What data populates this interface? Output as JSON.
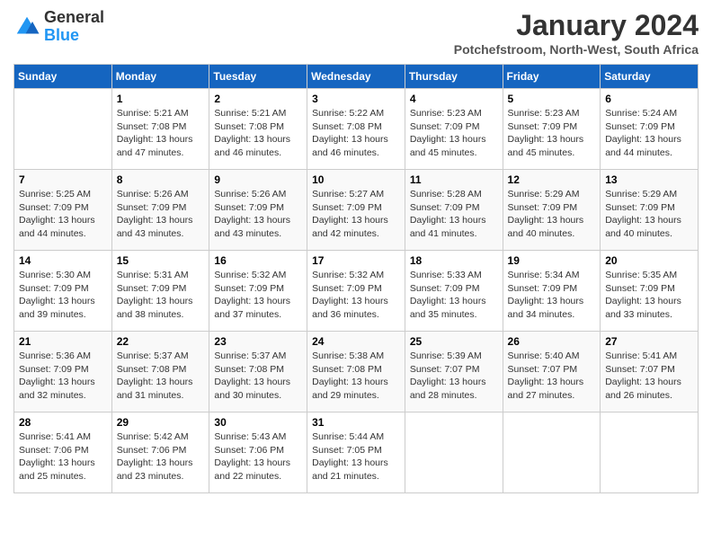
{
  "header": {
    "logo_general": "General",
    "logo_blue": "Blue",
    "month_year": "January 2024",
    "location": "Potchefstroom, North-West, South Africa"
  },
  "days_of_week": [
    "Sunday",
    "Monday",
    "Tuesday",
    "Wednesday",
    "Thursday",
    "Friday",
    "Saturday"
  ],
  "weeks": [
    [
      {
        "day": "",
        "info": ""
      },
      {
        "day": "1",
        "info": "Sunrise: 5:21 AM\nSunset: 7:08 PM\nDaylight: 13 hours\nand 47 minutes."
      },
      {
        "day": "2",
        "info": "Sunrise: 5:21 AM\nSunset: 7:08 PM\nDaylight: 13 hours\nand 46 minutes."
      },
      {
        "day": "3",
        "info": "Sunrise: 5:22 AM\nSunset: 7:08 PM\nDaylight: 13 hours\nand 46 minutes."
      },
      {
        "day": "4",
        "info": "Sunrise: 5:23 AM\nSunset: 7:09 PM\nDaylight: 13 hours\nand 45 minutes."
      },
      {
        "day": "5",
        "info": "Sunrise: 5:23 AM\nSunset: 7:09 PM\nDaylight: 13 hours\nand 45 minutes."
      },
      {
        "day": "6",
        "info": "Sunrise: 5:24 AM\nSunset: 7:09 PM\nDaylight: 13 hours\nand 44 minutes."
      }
    ],
    [
      {
        "day": "7",
        "info": "Sunrise: 5:25 AM\nSunset: 7:09 PM\nDaylight: 13 hours\nand 44 minutes."
      },
      {
        "day": "8",
        "info": "Sunrise: 5:26 AM\nSunset: 7:09 PM\nDaylight: 13 hours\nand 43 minutes."
      },
      {
        "day": "9",
        "info": "Sunrise: 5:26 AM\nSunset: 7:09 PM\nDaylight: 13 hours\nand 43 minutes."
      },
      {
        "day": "10",
        "info": "Sunrise: 5:27 AM\nSunset: 7:09 PM\nDaylight: 13 hours\nand 42 minutes."
      },
      {
        "day": "11",
        "info": "Sunrise: 5:28 AM\nSunset: 7:09 PM\nDaylight: 13 hours\nand 41 minutes."
      },
      {
        "day": "12",
        "info": "Sunrise: 5:29 AM\nSunset: 7:09 PM\nDaylight: 13 hours\nand 40 minutes."
      },
      {
        "day": "13",
        "info": "Sunrise: 5:29 AM\nSunset: 7:09 PM\nDaylight: 13 hours\nand 40 minutes."
      }
    ],
    [
      {
        "day": "14",
        "info": "Sunrise: 5:30 AM\nSunset: 7:09 PM\nDaylight: 13 hours\nand 39 minutes."
      },
      {
        "day": "15",
        "info": "Sunrise: 5:31 AM\nSunset: 7:09 PM\nDaylight: 13 hours\nand 38 minutes."
      },
      {
        "day": "16",
        "info": "Sunrise: 5:32 AM\nSunset: 7:09 PM\nDaylight: 13 hours\nand 37 minutes."
      },
      {
        "day": "17",
        "info": "Sunrise: 5:32 AM\nSunset: 7:09 PM\nDaylight: 13 hours\nand 36 minutes."
      },
      {
        "day": "18",
        "info": "Sunrise: 5:33 AM\nSunset: 7:09 PM\nDaylight: 13 hours\nand 35 minutes."
      },
      {
        "day": "19",
        "info": "Sunrise: 5:34 AM\nSunset: 7:09 PM\nDaylight: 13 hours\nand 34 minutes."
      },
      {
        "day": "20",
        "info": "Sunrise: 5:35 AM\nSunset: 7:09 PM\nDaylight: 13 hours\nand 33 minutes."
      }
    ],
    [
      {
        "day": "21",
        "info": "Sunrise: 5:36 AM\nSunset: 7:09 PM\nDaylight: 13 hours\nand 32 minutes."
      },
      {
        "day": "22",
        "info": "Sunrise: 5:37 AM\nSunset: 7:08 PM\nDaylight: 13 hours\nand 31 minutes."
      },
      {
        "day": "23",
        "info": "Sunrise: 5:37 AM\nSunset: 7:08 PM\nDaylight: 13 hours\nand 30 minutes."
      },
      {
        "day": "24",
        "info": "Sunrise: 5:38 AM\nSunset: 7:08 PM\nDaylight: 13 hours\nand 29 minutes."
      },
      {
        "day": "25",
        "info": "Sunrise: 5:39 AM\nSunset: 7:07 PM\nDaylight: 13 hours\nand 28 minutes."
      },
      {
        "day": "26",
        "info": "Sunrise: 5:40 AM\nSunset: 7:07 PM\nDaylight: 13 hours\nand 27 minutes."
      },
      {
        "day": "27",
        "info": "Sunrise: 5:41 AM\nSunset: 7:07 PM\nDaylight: 13 hours\nand 26 minutes."
      }
    ],
    [
      {
        "day": "28",
        "info": "Sunrise: 5:41 AM\nSunset: 7:06 PM\nDaylight: 13 hours\nand 25 minutes."
      },
      {
        "day": "29",
        "info": "Sunrise: 5:42 AM\nSunset: 7:06 PM\nDaylight: 13 hours\nand 23 minutes."
      },
      {
        "day": "30",
        "info": "Sunrise: 5:43 AM\nSunset: 7:06 PM\nDaylight: 13 hours\nand 22 minutes."
      },
      {
        "day": "31",
        "info": "Sunrise: 5:44 AM\nSunset: 7:05 PM\nDaylight: 13 hours\nand 21 minutes."
      },
      {
        "day": "",
        "info": ""
      },
      {
        "day": "",
        "info": ""
      },
      {
        "day": "",
        "info": ""
      }
    ]
  ]
}
